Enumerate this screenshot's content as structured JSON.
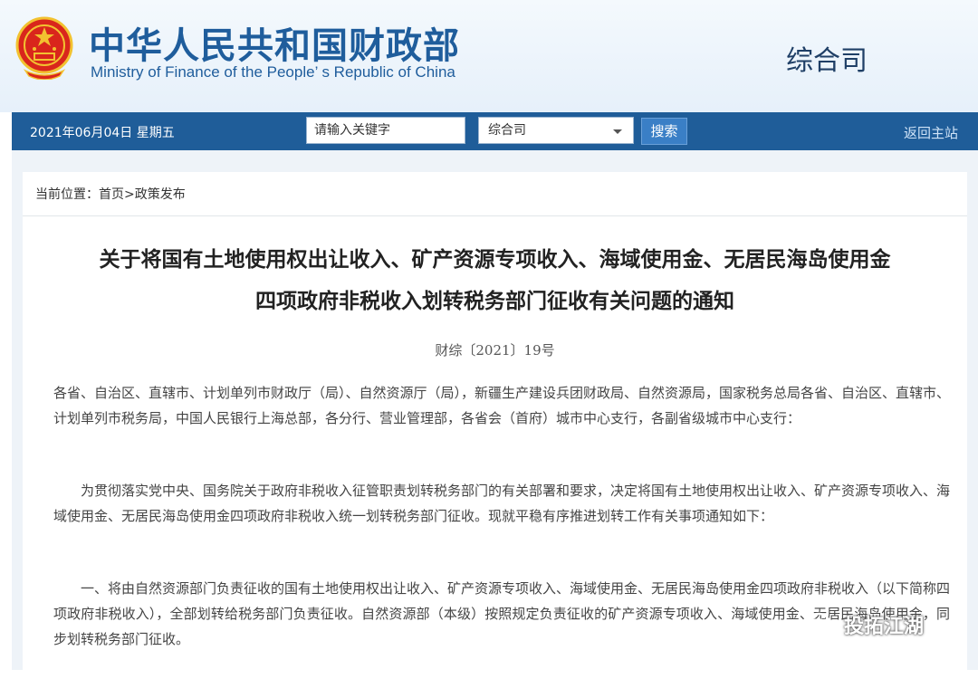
{
  "header": {
    "site_title": "中华人民共和国财政部",
    "site_subtitle": "Ministry of Finance of the People’ s Republic of China",
    "department": "综合司"
  },
  "navbar": {
    "date": "2021年06月04日  星期五",
    "search_placeholder": "请输入关键字",
    "dept_selected": "综合司",
    "search_label": "搜索",
    "home_label": "返回主站"
  },
  "breadcrumb": "当前位置：首页>政策发布",
  "document": {
    "title_line1": "关于将国有土地使用权出让收入、矿产资源专项收入、海域使用金、无居民海岛使用金",
    "title_line2": "四项政府非税收入划转税务部门征收有关问题的通知",
    "number": "财综〔2021〕19号",
    "paragraphs": [
      "各省、自治区、直辖市、计划单列市财政厅（局）、自然资源厅（局），新疆生产建设兵团财政局、自然资源局，国家税务总局各省、自治区、直辖市、计划单列市税务局，中国人民银行上海总部，各分行、营业管理部，各省会（首府）城市中心支行，各副省级城市中心支行：",
      "为贯彻落实党中央、国务院关于政府非税收入征管职责划转税务部门的有关部署和要求，决定将国有土地使用权出让收入、矿产资源专项收入、海域使用金、无居民海岛使用金四项政府非税收入统一划转税务部门征收。现就平稳有序推进划转工作有关事项通知如下：",
      "一、将由自然资源部门负责征收的国有土地使用权出让收入、矿产资源专项收入、海域使用金、无居民海岛使用金四项政府非税收入（以下简称四项政府非税收入），全部划转给税务部门负责征收。自然资源部（本级）按照规定负责征收的矿产资源专项收入、海域使用金、无居民海岛使用金，同步划转税务部门征收。"
    ]
  },
  "watermark": "投拓江湖"
}
